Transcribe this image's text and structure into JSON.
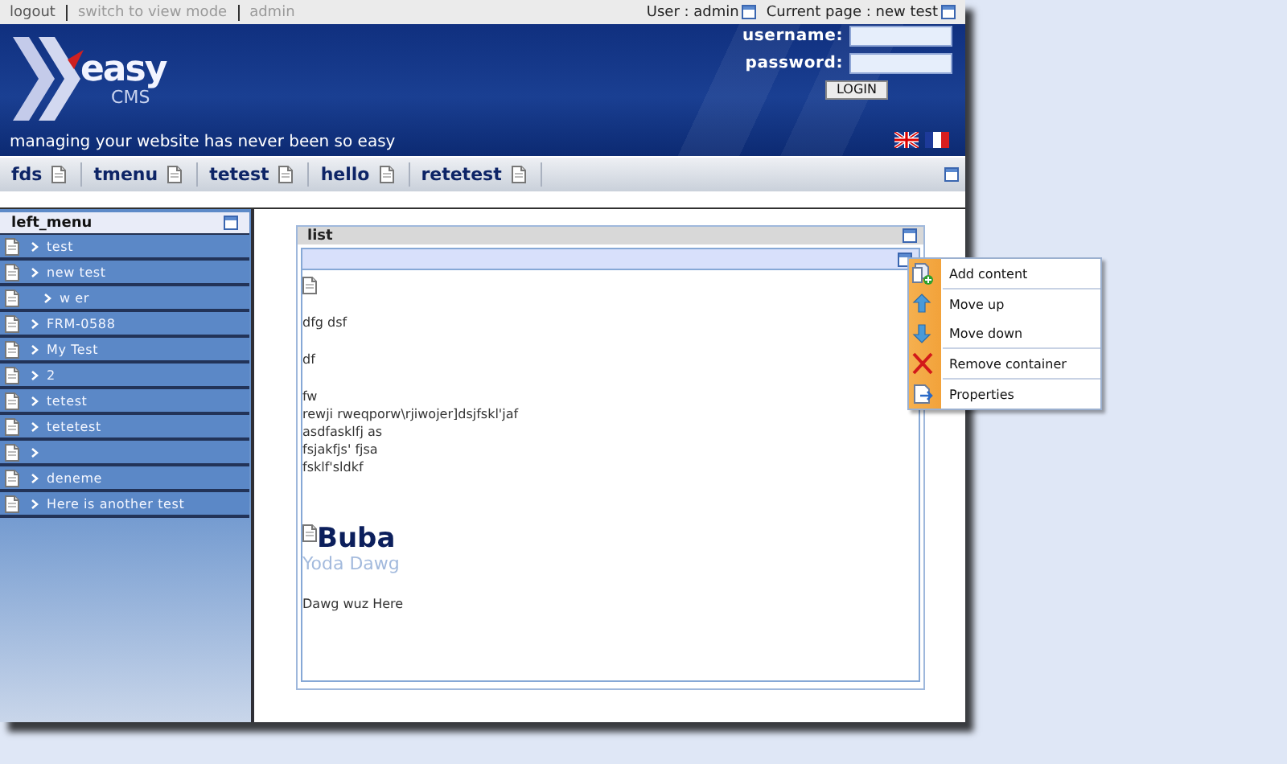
{
  "top_links": [
    {
      "label": "logout",
      "disabled": false
    },
    {
      "label": "switch to view mode",
      "disabled": true
    },
    {
      "label": "admin",
      "disabled": true
    }
  ],
  "user_info": {
    "user": "User : admin",
    "page": "Current page : new test"
  },
  "header": {
    "logo_word": "easy",
    "logo_sub": "CMS",
    "tagline": "managing your website has never been so easy",
    "username_label": "username:",
    "password_label": "password:",
    "login_button": "LOGIN"
  },
  "nav": [
    "fds",
    "tmenu",
    "tetest",
    "hello",
    "retetest"
  ],
  "left_menu": {
    "title": "left_menu",
    "items": [
      {
        "label": "test",
        "bullet": true
      },
      {
        "label": "new test",
        "bullet": true,
        "children": [
          {
            "label": "w er",
            "bullet": true
          }
        ]
      },
      {
        "label": "FRM-0588",
        "bullet": true
      },
      {
        "label": "My Test",
        "bullet": true
      },
      {
        "label": "2",
        "bullet": true
      },
      {
        "label": "tetest",
        "bullet": true
      },
      {
        "label": "tetetest",
        "bullet": true
      },
      {
        "bullet": true
      },
      {
        "label": "deneme",
        "bullet": true
      },
      {
        "label": "Here is another test",
        "bullet": true
      }
    ]
  },
  "list_panel": {
    "title": "list",
    "paragraphs": [
      [
        "dfg dsf"
      ],
      [
        "df"
      ],
      [
        "fw",
        "rewji rweqporw\\rjiwojer]dsjfskl'jaf",
        "asdfasklfj as",
        "fsjakfjs' fjsa",
        "fsklf'sldkf"
      ]
    ],
    "heading": "Buba",
    "subheading": "Yoda Dawg",
    "note": "Dawg wuz Here"
  },
  "context_menu": [
    [
      {
        "label": "Add content",
        "kind": "add"
      }
    ],
    [
      {
        "label": "Move up",
        "kind": "up"
      },
      {
        "label": "Move down",
        "kind": "down"
      }
    ],
    [
      {
        "label": "Remove container",
        "kind": "remove"
      }
    ],
    [
      {
        "label": "Properties",
        "kind": "properties"
      }
    ]
  ]
}
